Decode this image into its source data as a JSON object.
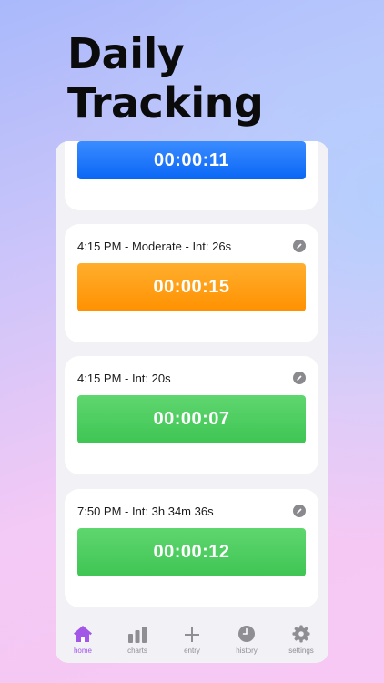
{
  "headline": {
    "line1": "Daily",
    "line2": "Tracking"
  },
  "colors": {
    "accent": "#a257e6",
    "blue": "#1677ff",
    "orange": "#ff9800",
    "green": "#4cd163"
  },
  "entries": [
    {
      "title": "",
      "timer": "00:00:11",
      "color": "blue"
    },
    {
      "title": "4:15 PM - Moderate - Int: 26s",
      "timer": "00:00:15",
      "color": "orange",
      "icon": "pencil-icon"
    },
    {
      "title": "4:15 PM - Int: 20s",
      "timer": "00:00:07",
      "color": "green",
      "icon": "pencil-icon"
    },
    {
      "title": "7:50 PM - Int: 3h 34m 36s",
      "timer": "00:00:12",
      "color": "green",
      "icon": "pencil-icon"
    }
  ],
  "tabbar": {
    "tabs": [
      {
        "label": "home",
        "icon": "house-icon",
        "active": true
      },
      {
        "label": "charts",
        "icon": "bar-chart-icon"
      },
      {
        "label": "entry",
        "icon": "plus-icon"
      },
      {
        "label": "history",
        "icon": "clock-icon"
      },
      {
        "label": "settings",
        "icon": "gear-icon"
      }
    ]
  }
}
